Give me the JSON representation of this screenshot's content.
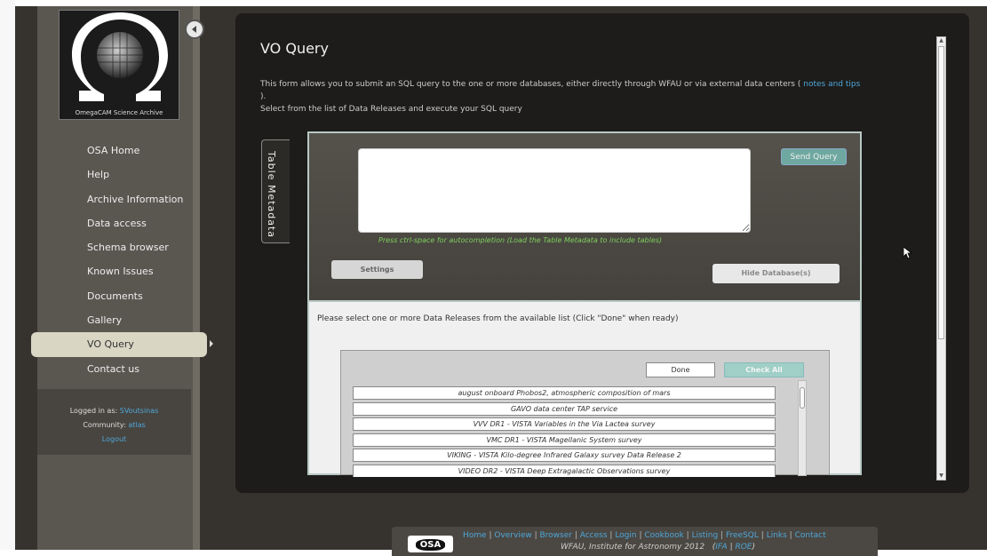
{
  "sidebar": {
    "logo_caption": "OmegaCAM Science Archive",
    "nav": [
      {
        "label": "OSA Home"
      },
      {
        "label": "Help"
      },
      {
        "label": "Archive Information"
      },
      {
        "label": "Data access"
      },
      {
        "label": "Schema browser"
      },
      {
        "label": "Known Issues"
      },
      {
        "label": "Documents"
      },
      {
        "label": "Gallery"
      },
      {
        "label": "VO Query",
        "active": true
      },
      {
        "label": "Contact us"
      }
    ],
    "login": {
      "logged_in_label": "Logged in as:",
      "username": "SVoutsinas",
      "community_label": "Community:",
      "community": "atlas",
      "logout": "Logout"
    }
  },
  "main": {
    "title": "VO Query",
    "desc_line1": "This form allows you to submit an SQL query to the one or more databases, either directly through WFAU or via external data centers (",
    "notes_link": "notes and tips",
    "desc_line1_end": ").",
    "desc_line2": "Select from the list of Data Releases and execute your SQL query",
    "table_metadata_tab": "Table Metadata",
    "query": {
      "sql_value": "",
      "send_label": "Send Query",
      "hint": "Press ctrl-space for autocompletion (Load the Table Metadata to include tables)",
      "settings_label": "Settings",
      "hide_db_label": "Hide Database(s)"
    },
    "select_msg": "Please select one or more Data Releases from the available list (Click \"Done\" when ready)",
    "done_label": "Done",
    "check_all_label": "Check All",
    "releases": [
      "august onboard Phobos2, atmospheric composition of mars",
      "GAVO data center TAP service",
      "VVV DR1 - VISTA Variables in the Via Lactea survey",
      "VMC DR1 - VISTA Magellanic System survey",
      "VIKING - VISTA Kilo-degree Infrared Galaxy survey Data Release 2",
      "VIDEO DR2 - VISTA Deep Extragalactic Observations survey"
    ]
  },
  "footer": {
    "logo_text": "OSA",
    "links": [
      "Home",
      "Overview",
      "Browser",
      "Access",
      "Login",
      "Cookbook",
      "Listing",
      "FreeSQL",
      "Links",
      "Contact"
    ],
    "copyright": "WFAU, Institute for Astronomy 2012",
    "org_links": [
      "IFA",
      "ROE"
    ]
  },
  "colors": {
    "accent_link": "#4ea6d8",
    "send_button": "#6ea8a0",
    "hint_text": "#7ecf5e"
  }
}
